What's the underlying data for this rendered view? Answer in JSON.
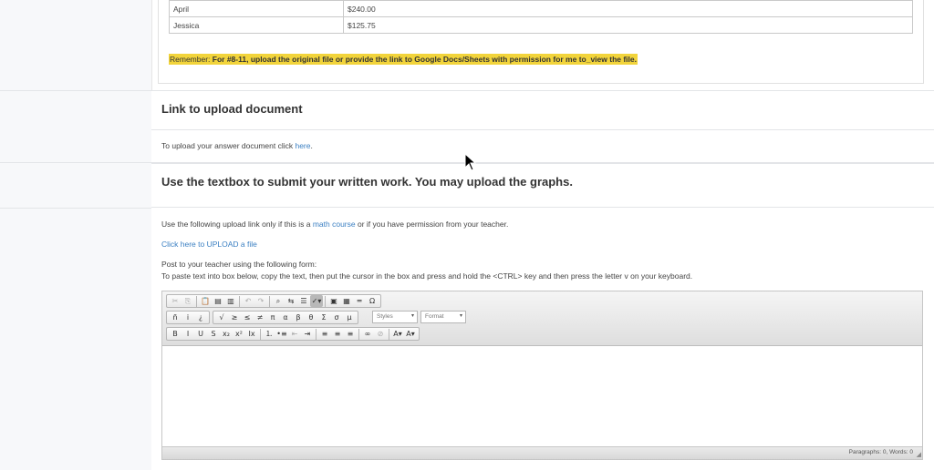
{
  "payments": [
    {
      "name": "April",
      "amount": "$240.00"
    },
    {
      "name": "Jessica",
      "amount": "$125.75"
    }
  ],
  "remember": {
    "label": "Remember:",
    "text": " For #8-11, upload the original file or provide the link to Google Docs/Sheets with permission for me to_view the file."
  },
  "link_section": {
    "heading": "Link to upload document",
    "text_before": "To upload your answer document click ",
    "link": "here",
    "text_after": "."
  },
  "text_section": {
    "heading": "Use the textbox to submit your written work.  You may upload the graphs.",
    "line1_before": "Use the following upload link only if this is a ",
    "line1_link": "math course",
    "line1_after": " or if you have permission from your teacher.",
    "upload_link": "Click here to UPLOAD a file",
    "line2": "Post to your teacher using the following form:",
    "line3": "To paste text into box below, copy the text, then put the cursor in the box and press and hold the <CTRL> key and then press the letter v on your keyboard."
  },
  "editor": {
    "row1": [
      {
        "icon": "cut-icon",
        "glyph": "✂",
        "dim": true
      },
      {
        "icon": "copy-icon",
        "glyph": "⎘",
        "dim": true
      },
      {
        "icon": "paste-icon",
        "glyph": "📋"
      },
      {
        "icon": "paste-text-icon",
        "glyph": "▤"
      },
      {
        "icon": "paste-word-icon",
        "glyph": "▥"
      },
      {
        "icon": "undo-icon",
        "glyph": "↶",
        "dim": true
      },
      {
        "icon": "redo-icon",
        "glyph": "↷",
        "dim": true
      },
      {
        "icon": "find-icon",
        "glyph": "⌕"
      },
      {
        "icon": "replace-icon",
        "glyph": "⇆"
      },
      {
        "icon": "select-all-icon",
        "glyph": "☰"
      },
      {
        "icon": "spellcheck-icon",
        "glyph": "✓▾",
        "on": true
      },
      {
        "icon": "image-icon",
        "glyph": "▣"
      },
      {
        "icon": "table-icon",
        "glyph": "▦"
      },
      {
        "icon": "horizontal-line-icon",
        "glyph": "═"
      },
      {
        "icon": "special-char-icon",
        "glyph": "Ω"
      }
    ],
    "row2": [
      "ñ",
      "i",
      "¿",
      "√",
      "≥",
      "≤",
      "≠",
      "π",
      "α",
      "β",
      "θ",
      "Σ",
      "σ",
      "μ"
    ],
    "styles_label": "Styles",
    "format_label": "Format",
    "row3": [
      {
        "icon": "bold-icon",
        "glyph": "B"
      },
      {
        "icon": "italic-icon",
        "glyph": "I"
      },
      {
        "icon": "underline-icon",
        "glyph": "U"
      },
      {
        "icon": "strikethrough-icon",
        "glyph": "S"
      },
      {
        "icon": "subscript-icon",
        "glyph": "x₂"
      },
      {
        "icon": "superscript-icon",
        "glyph": "x²"
      },
      {
        "icon": "remove-format-icon",
        "glyph": "Ix"
      },
      {
        "icon": "numbered-list-icon",
        "glyph": "⒈"
      },
      {
        "icon": "bulleted-list-icon",
        "glyph": "•≡"
      },
      {
        "icon": "outdent-icon",
        "glyph": "⇤",
        "dim": true
      },
      {
        "icon": "indent-icon",
        "glyph": "⇥"
      },
      {
        "icon": "align-left-icon",
        "glyph": "≡"
      },
      {
        "icon": "align-center-icon",
        "glyph": "≡"
      },
      {
        "icon": "align-right-icon",
        "glyph": "≡"
      },
      {
        "icon": "link-icon",
        "glyph": "∞"
      },
      {
        "icon": "unlink-icon",
        "glyph": "⊘",
        "dim": true
      },
      {
        "icon": "text-color-icon",
        "glyph": "A▾"
      },
      {
        "icon": "background-color-icon",
        "glyph": "A▾"
      }
    ],
    "status": "Paragraphs: 0, Words: 0"
  }
}
